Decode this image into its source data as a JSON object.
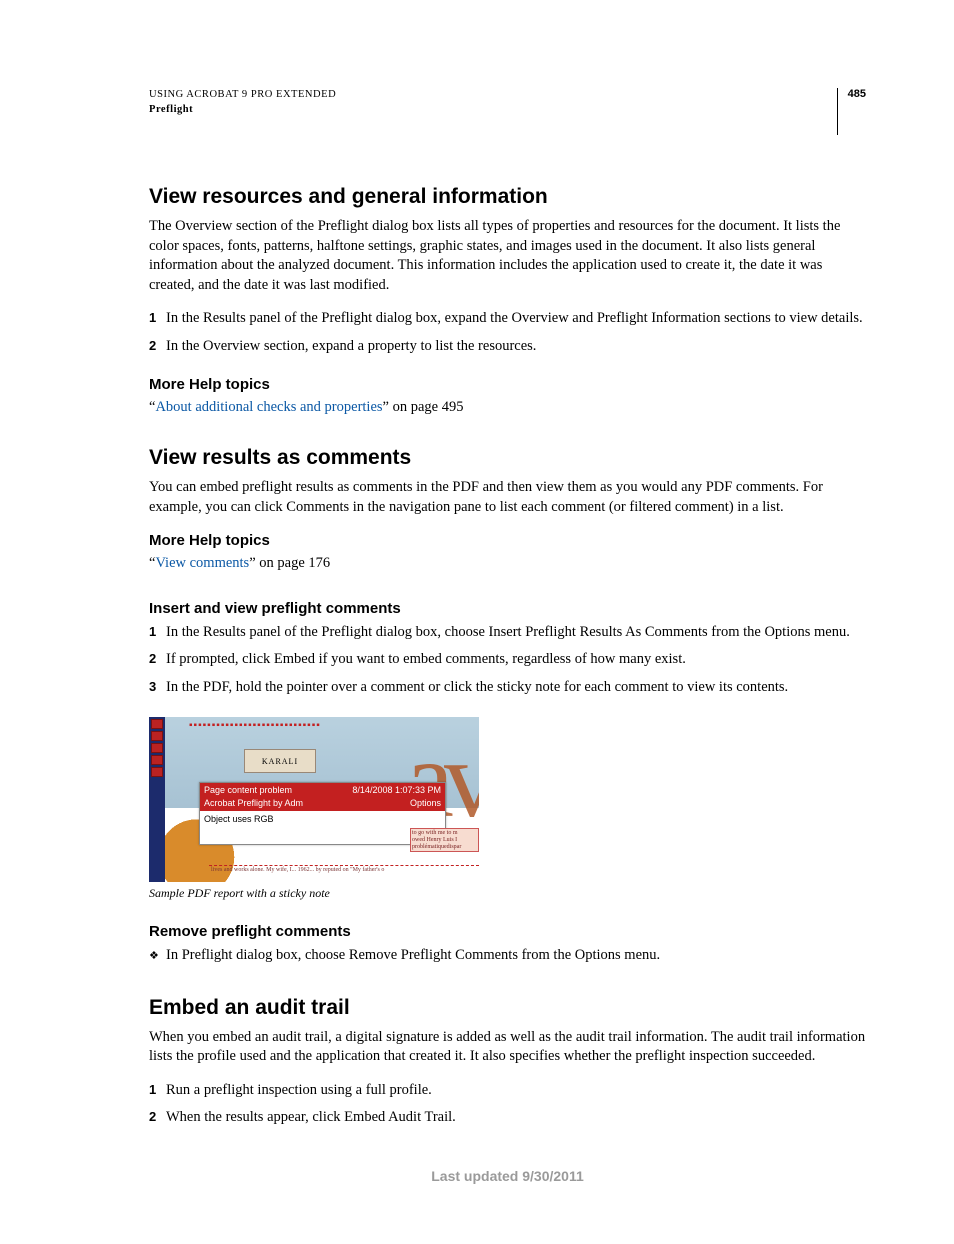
{
  "header": {
    "line1": "USING ACROBAT 9 PRO EXTENDED",
    "line2": "Preflight",
    "page_number": "485"
  },
  "section1": {
    "title": "View resources and general information",
    "body": "The Overview section of the Preflight dialog box lists all types of properties and resources for the document. It lists the color spaces, fonts, patterns, halftone settings, graphic states, and images used in the document. It also lists general information about the analyzed document. This information includes the application used to create it, the date it was created, and the date it was last modified.",
    "steps": [
      "In the Results panel of the Preflight dialog box, expand the Overview and Preflight Information sections to view details.",
      "In the Overview section, expand a property to list the resources."
    ],
    "more_help_title": "More Help topics",
    "xref_q1": "“",
    "xref_link": "About additional checks and properties",
    "xref_tail": "” on page 495"
  },
  "section2": {
    "title": "View results as comments",
    "body": "You can embed preflight results as comments in the PDF and then view them as you would any PDF comments. For example, you can click Comments in the navigation pane to list each comment (or filtered comment) in a list.",
    "more_help_title": "More Help topics",
    "xref_q1": "“",
    "xref_link": "View comments",
    "xref_tail": "” on page 176",
    "sub1_title": "Insert and view preflight comments",
    "sub1_steps": [
      "In the Results panel of the Preflight dialog box, choose Insert Preflight Results As Comments from the Options menu.",
      "If prompted, click Embed if you want to embed comments, regardless of how many exist.",
      "In the PDF, hold the pointer over a comment or click the sticky note for each comment to view its contents."
    ],
    "figure": {
      "popup_title": "Page content problem",
      "popup_date": "8/14/2008 1:07:33 PM",
      "popup_author": "Acrobat Preflight by Adm",
      "popup_options": "Options",
      "popup_content": "Object uses RGB",
      "big_letters": "av",
      "smallbox": "KARALI",
      "caption": "Sample PDF report with a sticky note"
    },
    "sub2_title": "Remove preflight comments",
    "sub2_bullet": "In Preflight dialog box, choose Remove Preflight Comments from the Options menu."
  },
  "section3": {
    "title": "Embed an audit trail",
    "body": "When you embed an audit trail, a digital signature is added as well as the audit trail information. The audit trail information lists the profile used and the application that created it. It also specifies whether the preflight inspection succeeded.",
    "steps": [
      "Run a preflight inspection using a full profile.",
      "When the results appear, click Embed Audit Trail."
    ]
  },
  "footer": "Last updated 9/30/2011"
}
